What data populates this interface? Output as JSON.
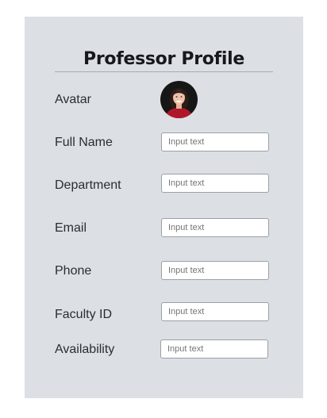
{
  "page": {
    "title": "Professor Profile"
  },
  "form": {
    "avatar_label": "Avatar",
    "fields": [
      {
        "label": "Full Name",
        "placeholder": "Input text"
      },
      {
        "label": "Department",
        "placeholder": "Input text"
      },
      {
        "label": "Email",
        "placeholder": "Input text"
      },
      {
        "label": "Phone",
        "placeholder": "Input text"
      },
      {
        "label": "Faculty ID",
        "placeholder": "Input text"
      },
      {
        "label": "Availability",
        "placeholder": "Input text"
      }
    ]
  },
  "colors": {
    "card_background": "#dcdfe4",
    "title_text": "#16181d",
    "label_text": "#2a2d33",
    "input_border": "#9aa0a8",
    "avatar_sweater": "#b0162a"
  }
}
